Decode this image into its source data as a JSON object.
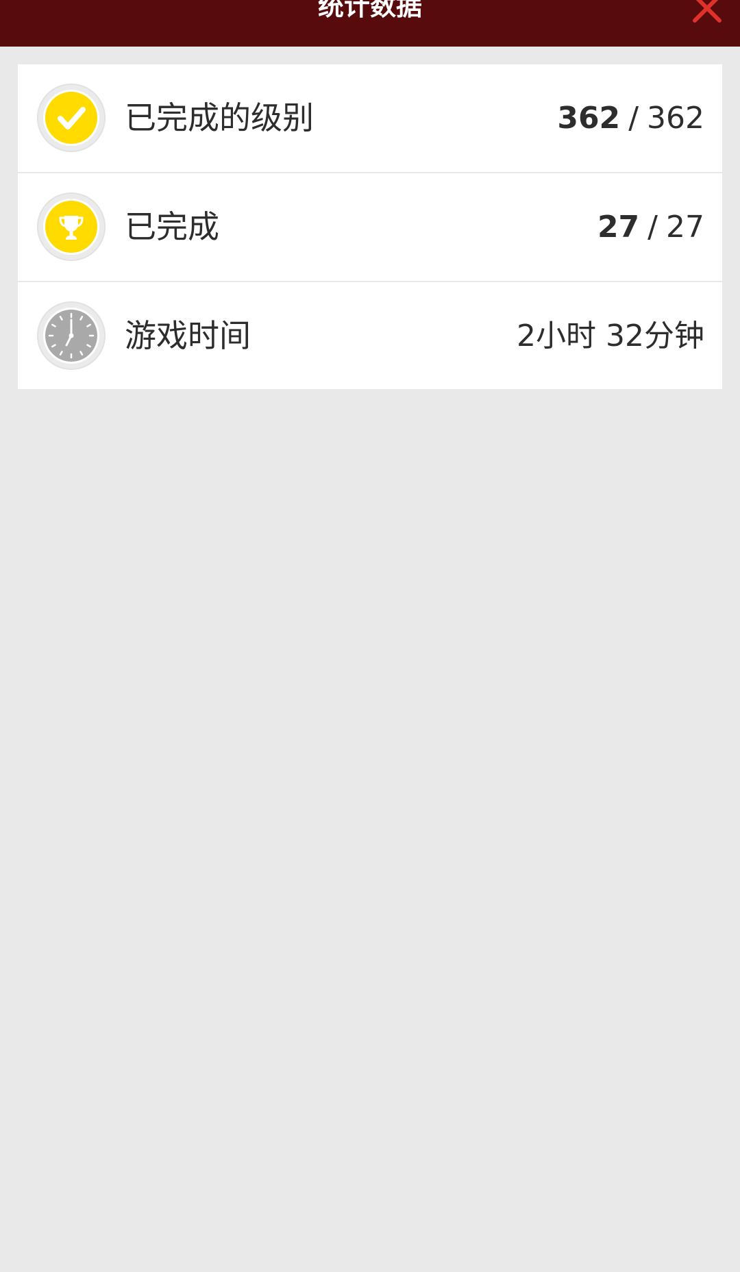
{
  "header": {
    "title": "统计数据",
    "close_icon": "close-icon",
    "background_color": "#570b0c",
    "close_color": "#e0312b"
  },
  "stats": [
    {
      "icon": "checkmark-icon",
      "label": "已完成的级别",
      "current": "362",
      "separator": "/",
      "total": "362"
    },
    {
      "icon": "trophy-icon",
      "label": "已完成",
      "current": "27",
      "separator": "/",
      "total": "27"
    },
    {
      "icon": "clock-icon",
      "label": "游戏时间",
      "value": "2小时 32分钟"
    }
  ],
  "colors": {
    "accent_yellow": "#ffdb00",
    "clock_grey": "#a9a9a9",
    "page_background": "#e9e9e9"
  }
}
